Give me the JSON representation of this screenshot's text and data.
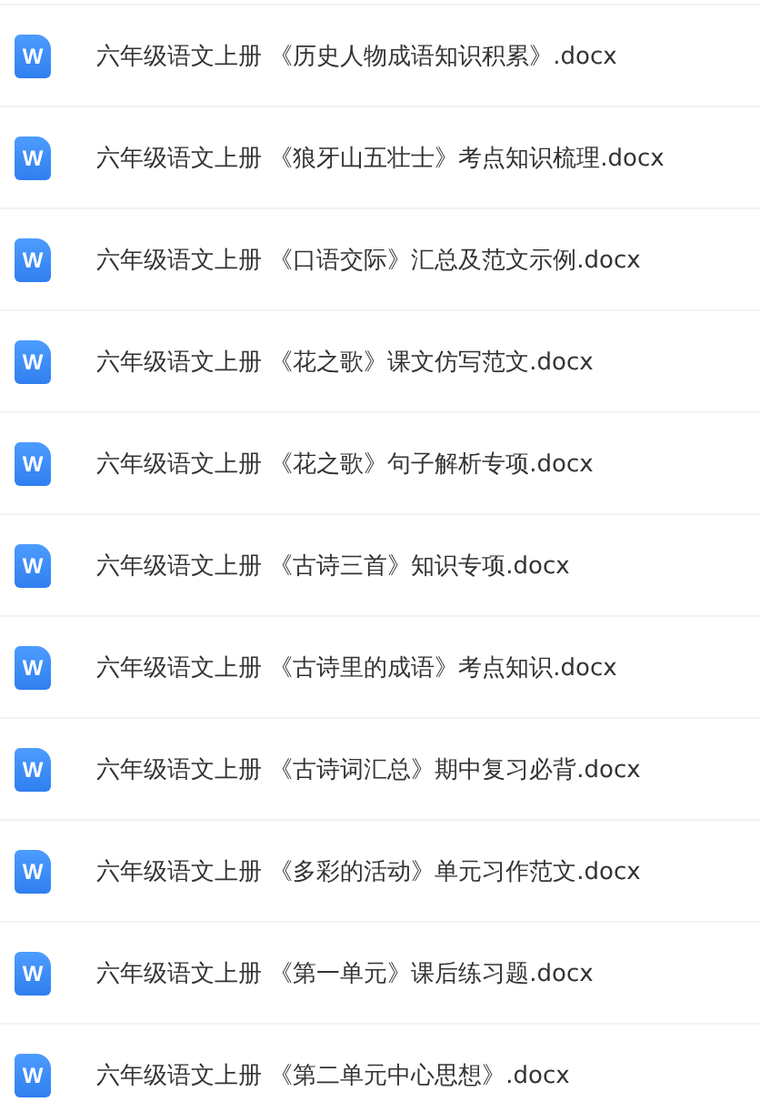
{
  "files": [
    {
      "name": "六年级语文上册 《历史人物成语知识积累》.docx",
      "icon_letter": "W"
    },
    {
      "name": "六年级语文上册 《狼牙山五壮士》考点知识梳理.docx",
      "icon_letter": "W"
    },
    {
      "name": "六年级语文上册 《口语交际》汇总及范文示例.docx",
      "icon_letter": "W"
    },
    {
      "name": "六年级语文上册 《花之歌》课文仿写范文.docx",
      "icon_letter": "W"
    },
    {
      "name": "六年级语文上册 《花之歌》句子解析专项.docx",
      "icon_letter": "W"
    },
    {
      "name": "六年级语文上册 《古诗三首》知识专项.docx",
      "icon_letter": "W"
    },
    {
      "name": "六年级语文上册 《古诗里的成语》考点知识.docx",
      "icon_letter": "W"
    },
    {
      "name": "六年级语文上册 《古诗词汇总》期中复习必背.docx",
      "icon_letter": "W"
    },
    {
      "name": "六年级语文上册 《多彩的活动》单元习作范文.docx",
      "icon_letter": "W"
    },
    {
      "name": "六年级语文上册 《第一单元》课后练习题.docx",
      "icon_letter": "W"
    },
    {
      "name": "六年级语文上册 《第二单元中心思想》.docx",
      "icon_letter": "W"
    }
  ]
}
